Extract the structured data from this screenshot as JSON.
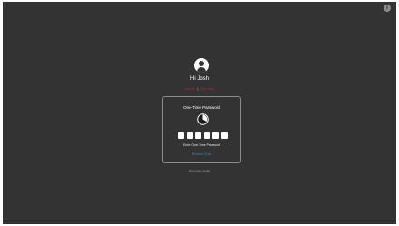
{
  "header": {
    "info_icon": "info-icon",
    "info_glyph": "i"
  },
  "user": {
    "avatar_icon": "user-avatar-icon",
    "greeting": "Hi Josh"
  },
  "links": {
    "left": "Log out",
    "separator": "|",
    "right": "Not Josh?"
  },
  "otp_card": {
    "title": "One-Time Password",
    "timer_icon": "countdown-timer-icon",
    "digit_count": 6,
    "input_label": "Enter One-Time Password",
    "resend_label": "Resend Code"
  },
  "footer": {
    "text": "Remember details"
  },
  "colors": {
    "background": "#333333",
    "accent_link": "#b02a3a",
    "resend_link": "#4a7fc1",
    "card_border": "#8c8c8c"
  }
}
